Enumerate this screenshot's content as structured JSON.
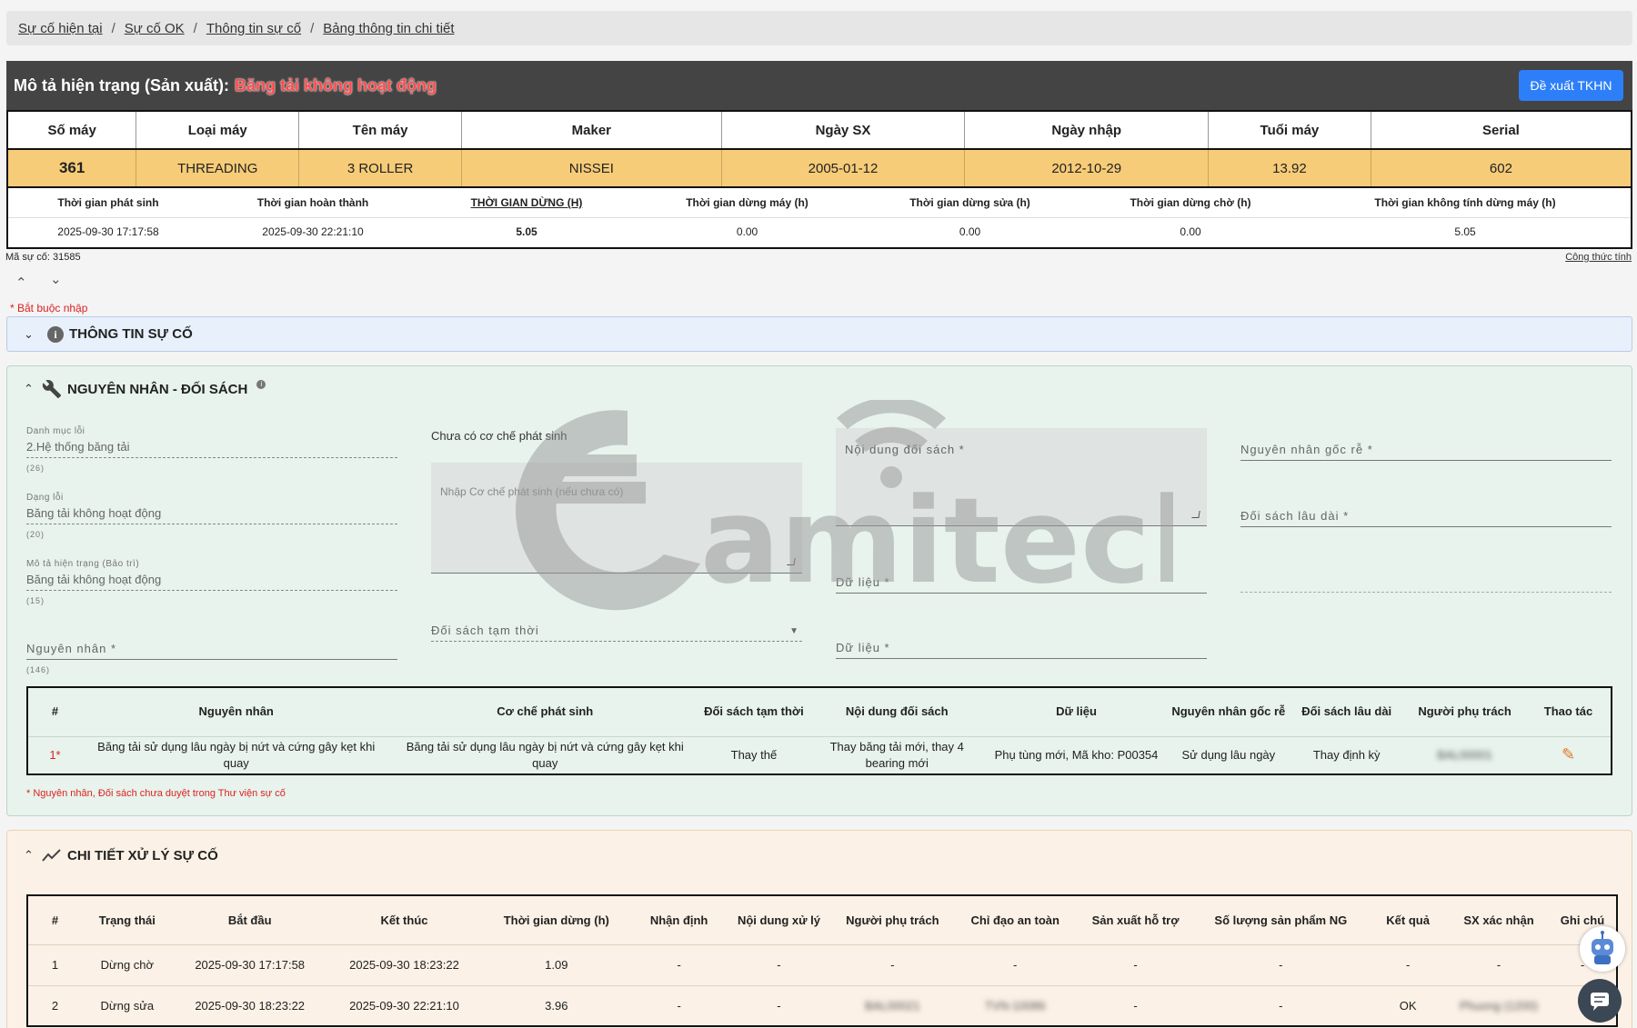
{
  "breadcrumb": [
    "Sự cố hiện tại",
    "Sự cố OK",
    "Thông tin sự cố",
    "Bảng thông tin chi tiết"
  ],
  "header": {
    "label": "Mô tả hiện trạng (Sản xuất):",
    "status": "Băng tải không hoạt động",
    "button": "Đề xuất TKHN"
  },
  "machine": {
    "headers": [
      "Số máy",
      "Loại máy",
      "Tên máy",
      "Maker",
      "Ngày SX",
      "Ngày nhập",
      "Tuổi máy",
      "Serial"
    ],
    "values": [
      "361",
      "THREADING",
      "3 ROLLER",
      "NISSEI",
      "2005-01-12",
      "2012-10-29",
      "13.92",
      "602"
    ]
  },
  "times": {
    "headers": [
      "Thời gian phát sinh",
      "Thời gian hoàn thành",
      "THỜI GIAN DỪNG (H)",
      "Thời gian dừng máy (h)",
      "Thời gian dừng sửa (h)",
      "Thời gian dừng chờ (h)",
      "Thời gian không tính dừng máy (h)"
    ],
    "values": [
      "2025-09-30 17:17:58",
      "2025-09-30 22:21:10",
      "5.05",
      "0.00",
      "0.00",
      "0.00",
      "5.05"
    ]
  },
  "ma_su_co": "Mã sự cố: 31585",
  "cong_thuc": "Công thức tính",
  "required_note": "* Bắt buộc nhập",
  "sec_info": {
    "title": "THÔNG TIN SỰ CỐ"
  },
  "sec_cause": {
    "title": "NGUYÊN NHÂN - ĐỐI SÁCH",
    "danh_muc": {
      "label": "Danh mục lỗi",
      "value": "2.Hệ thống băng tải",
      "count": "(26)"
    },
    "dang_loi": {
      "label": "Dạng lỗi",
      "value": "Băng tải không hoạt động",
      "count": "(20)"
    },
    "mo_ta": {
      "label": "Mô tả hiện trạng (Bảo trì)",
      "value": "Băng tải không hoạt động",
      "count": "(15)"
    },
    "nguyen_nhan": {
      "placeholder": "Nguyên nhân *",
      "count": "(146)"
    },
    "co_che_title": "Chưa có cơ chế phát sinh",
    "co_che_placeholder": "Nhập Cơ chế phát sinh (nếu chưa có)",
    "doi_sach_tam_thoi": "Đối sách tạm thời",
    "noi_dung_doi_sach": "Nội dung đối sách *",
    "du_lieu_1": "Dữ liệu *",
    "du_lieu_2": "Dữ liệu *",
    "nguyen_nhan_goc_re": "Nguyên nhân gốc rễ *",
    "doi_sach_lau_dai": "Đối sách lâu dài *",
    "table": {
      "headers": [
        "#",
        "Nguyên nhân",
        "Cơ chế phát sinh",
        "Đối sách tạm thời",
        "Nội dung đối sách",
        "Dữ liệu",
        "Nguyên nhân gốc rễ",
        "Đối sách lâu dài",
        "Người phụ trách",
        "Thao tác"
      ],
      "rows": [
        [
          "1*",
          "Băng tải sử dụng lâu ngày bị nứt và cứng gây kẹt khi quay",
          "Băng tải sử dụng lâu ngày bị nứt và cứng gây kẹt khi quay",
          "Thay thế",
          "Thay băng tải mới, thay 4 bearing mới",
          "Phụ tùng mới, Mã kho: P00354",
          "Sử dụng lâu ngày",
          "Thay định kỳ",
          "BAL00001"
        ]
      ]
    },
    "note": "* Nguyên nhân, Đối sách chưa duyệt trong Thư viện sự cố"
  },
  "sec_process": {
    "title": "CHI TIẾT XỬ LÝ SỰ CỐ",
    "headers": [
      "#",
      "Trạng thái",
      "Bắt đầu",
      "Kết thúc",
      "Thời gian dừng (h)",
      "Nhận định",
      "Nội dung xử lý",
      "Người phụ trách",
      "Chỉ đạo an toàn",
      "Sản xuất hỗ trợ",
      "Số lượng sản phẩm NG",
      "Kết quả",
      "SX xác nhận",
      "Ghi chú"
    ],
    "rows": [
      [
        "1",
        "Dừng chờ",
        "2025-09-30 17:17:58",
        "2025-09-30 18:23:22",
        "1.09",
        "-",
        "-",
        "-",
        "-",
        "-",
        "-",
        "-",
        "-",
        "-"
      ],
      [
        "2",
        "Dừng sửa",
        "2025-09-30 18:23:22",
        "2025-09-30 22:21:10",
        "3.96",
        "-",
        "-",
        "BAL00021",
        "TVN-10086",
        "-",
        "-",
        "OK",
        "Phuong (1200)",
        "-"
      ]
    ]
  },
  "watermark": "amitech",
  "colors": {
    "header_bg": "#444444",
    "status_red": "#ff4a4a",
    "machine_row": "#f7cc78",
    "accent_blue": "#2d7ff9"
  }
}
